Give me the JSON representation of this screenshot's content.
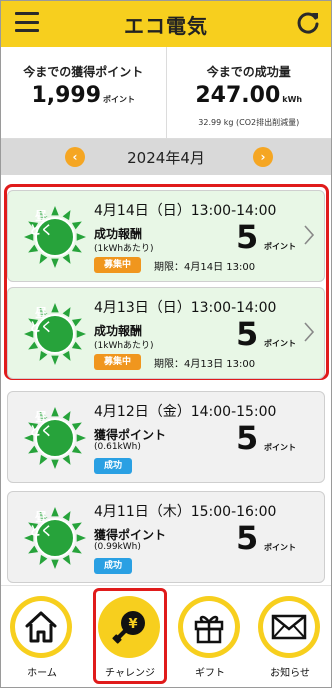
{
  "header": {
    "title": "エコ電気"
  },
  "summary": {
    "points_label": "今までの獲得ポイント",
    "points_value": "1,999",
    "points_unit": "ポイント",
    "savings_label": "今までの成功量",
    "savings_value": "247.00",
    "savings_unit": "kWh",
    "savings_note": "32.99 kg (CO2排出削減量)"
  },
  "month": {
    "label": "2024年4月",
    "prev": "‹",
    "next": "›"
  },
  "sun_label": [
    "昼",
    "とく"
  ],
  "cards": [
    {
      "date": "4月14日（日）13:00-14:00",
      "type": "成功報酬",
      "sub": "(1kWhあたり)",
      "badge": "募集中",
      "deadline": "期限：4月14日 13:00",
      "points": "5",
      "points_unit": "ポイント"
    },
    {
      "date": "4月13日（日）13:00-14:00",
      "type": "成功報酬",
      "sub": "(1kWhあたり)",
      "badge": "募集中",
      "deadline": "期限：4月13日 13:00",
      "points": "5",
      "points_unit": "ポイント"
    },
    {
      "date": "4月12日（金）14:00-15:00",
      "type": "獲得ポイント",
      "sub": "(0.61kWh)",
      "badge": "成功",
      "points": "5",
      "points_unit": "ポイント"
    },
    {
      "date": "4月11日（木）15:00-16:00",
      "type": "獲得ポイント",
      "sub": "(0.99kWh)",
      "badge": "成功",
      "points": "5",
      "points_unit": "ポイント"
    }
  ],
  "nav": [
    {
      "label": "ホーム",
      "icon": "home-icon"
    },
    {
      "label": "チャレンジ",
      "icon": "lightbulb-yen-icon"
    },
    {
      "label": "ギフト",
      "icon": "gift-icon"
    },
    {
      "label": "お知らせ",
      "icon": "mail-icon"
    }
  ],
  "colors": {
    "brand": "#f7cf1e",
    "accent_orange": "#f0961e",
    "success_blue": "#2aa0e3",
    "sun_green": "#27a33b",
    "highlight_red": "#e01b1b"
  }
}
